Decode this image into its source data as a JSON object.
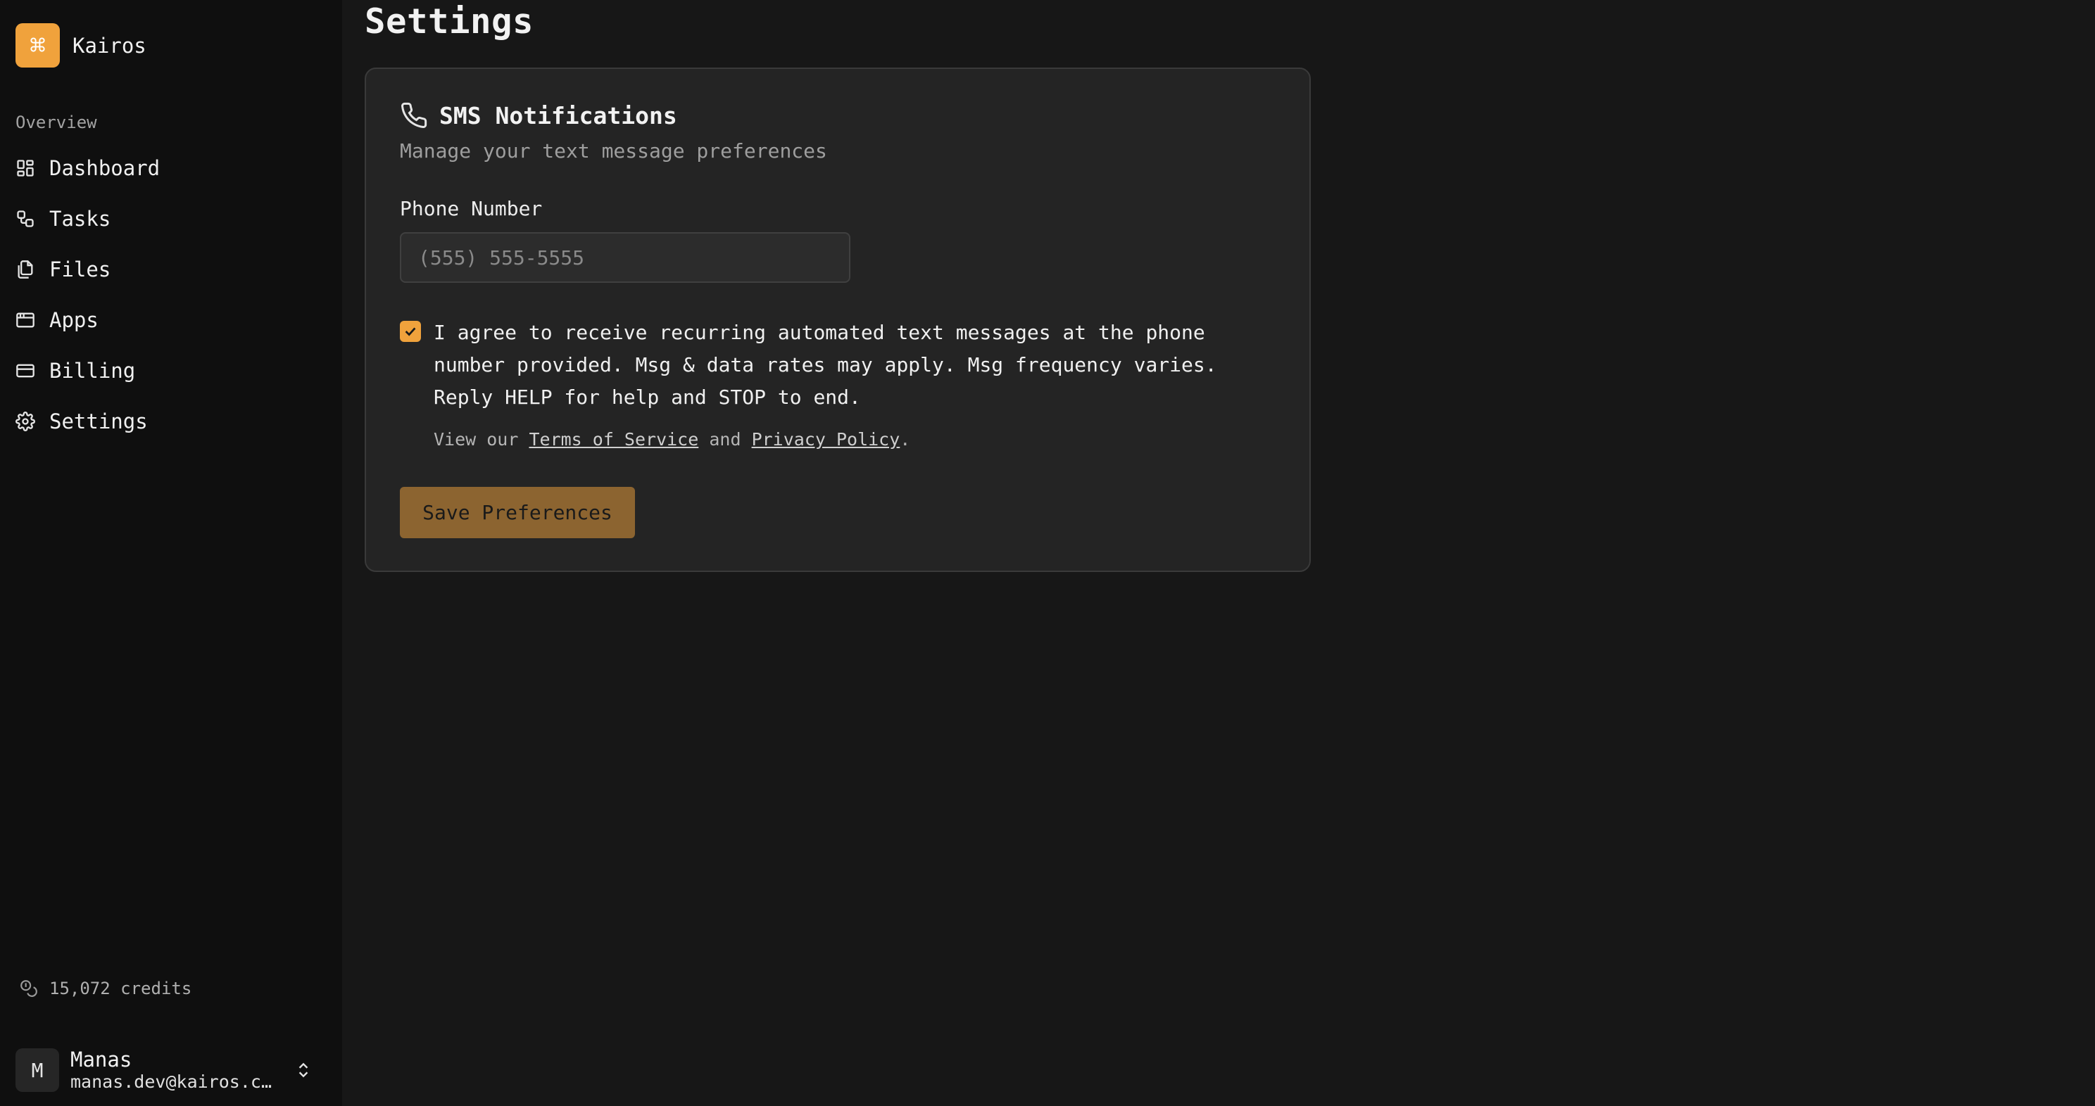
{
  "app": {
    "name": "Kairos",
    "logo_glyph": "⌘",
    "accent": "#f0a23c"
  },
  "sidebar": {
    "section_label": "Overview",
    "items": [
      {
        "label": "Dashboard",
        "icon": "dashboard-icon"
      },
      {
        "label": "Tasks",
        "icon": "tasks-icon"
      },
      {
        "label": "Files",
        "icon": "files-icon"
      },
      {
        "label": "Apps",
        "icon": "apps-icon"
      },
      {
        "label": "Billing",
        "icon": "billing-icon"
      },
      {
        "label": "Settings",
        "icon": "gear-icon"
      }
    ],
    "credits": "15,072 credits",
    "user": {
      "initial": "M",
      "name": "Manas",
      "email": "manas.dev@kairos.com"
    }
  },
  "page": {
    "title": "Settings"
  },
  "card": {
    "title": "SMS Notifications",
    "subtitle": "Manage your text message preferences",
    "phone": {
      "label": "Phone Number",
      "value": "",
      "placeholder": "(555) 555-5555"
    },
    "consent": {
      "checked": true,
      "text": "I agree to receive recurring automated text messages at the phone number provided. Msg & data rates may apply. Msg frequency varies. Reply HELP for help and STOP to end."
    },
    "legal": {
      "prefix": "View our ",
      "terms": "Terms of Service",
      "and": " and ",
      "privacy": "Privacy Policy",
      "suffix": "."
    },
    "save_label": "Save Preferences"
  }
}
